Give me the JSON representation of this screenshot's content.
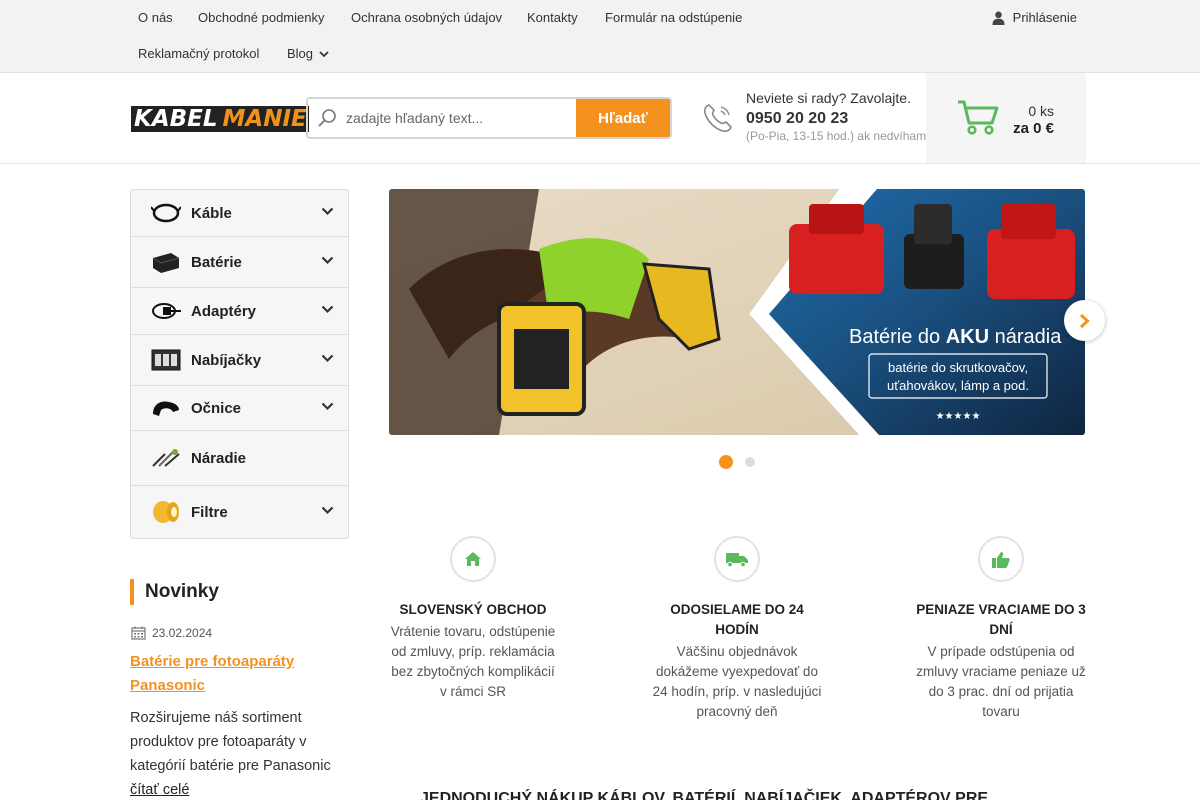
{
  "topnav": {
    "links": [
      "O nás",
      "Obchodné podmienky",
      "Ochrana osobných údajov",
      "Kontakty",
      "Formulár na odstúpenie",
      "Reklamačný protokol",
      "Blog"
    ],
    "login": "Prihlásenie"
  },
  "header": {
    "logo_part1": "KABEL",
    "logo_part2": "MANIE",
    "search_placeholder": "zadajte hľadaný text...",
    "search_button": "Hľadať",
    "contact_question": "Neviete si rady? Zavolajte.",
    "contact_phone": "0950 20 20 23",
    "contact_hours": "(Po-Pia, 13-15 hod.) ak nedvíham",
    "cart_count": "0 ks",
    "cart_total": "za 0 €"
  },
  "categories": [
    {
      "label": "Káble",
      "icon": "cable-icon",
      "has_submenu": true
    },
    {
      "label": "Batérie",
      "icon": "battery-icon",
      "has_submenu": true
    },
    {
      "label": "Adaptéry",
      "icon": "adapter-icon",
      "has_submenu": true
    },
    {
      "label": "Nabíjačky",
      "icon": "charger-icon",
      "has_submenu": true
    },
    {
      "label": "Očnice",
      "icon": "eyecup-icon",
      "has_submenu": true
    },
    {
      "label": "Náradie",
      "icon": "tools-icon",
      "has_submenu": false
    },
    {
      "label": "Filtre",
      "icon": "filter-icon",
      "has_submenu": true
    }
  ],
  "banner": {
    "title_prefix": "Batérie do ",
    "title_bold": "AKU",
    "title_suffix": " náradia",
    "subtitle_line1": "batérie do skrutkovačov,",
    "subtitle_line2": "uťahovákov, lámp a pod.",
    "stars": "★★★★★",
    "slides_total": 2,
    "slide_active": 1
  },
  "features": [
    {
      "icon": "house-icon",
      "heading": "SLOVENSKÝ OBCHOD",
      "text": "Vrátenie tovaru, odstúpenie od zmluvy, príp. reklamácia bez zbytočných komplikácií v rámci SR"
    },
    {
      "icon": "truck-icon",
      "heading": "ODOSIELAME DO 24 HODÍN",
      "text": "Väčšinu objednávok dokážeme vyexpedovať do 24 hodín, príp. v nasledujúci pracovný deň"
    },
    {
      "icon": "thumbs-up-icon",
      "heading": "PENIAZE VRACIAME DO 3 DNÍ",
      "text": "V prípade odstúpenia od zmluvy vraciame peniaze už do 3 prac. dní od prijatia tovaru"
    }
  ],
  "news": {
    "title": "Novinky",
    "date": "23.02.2024",
    "headline": "Batérie pre fotoaparáty Panasonic",
    "text": "Rozširujeme náš sortiment produktov pre fotoaparáty v kategórií batérie pre Panasonic",
    "more": "čítať celé"
  },
  "bottom_heading": "JEDNODUCHÝ NÁKUP KÁBLOV, BATÉRIÍ, NABÍJAČIEK, ADAPTÉROV PRE",
  "colors": {
    "accent": "#f5921e",
    "green": "#5cb85c"
  }
}
